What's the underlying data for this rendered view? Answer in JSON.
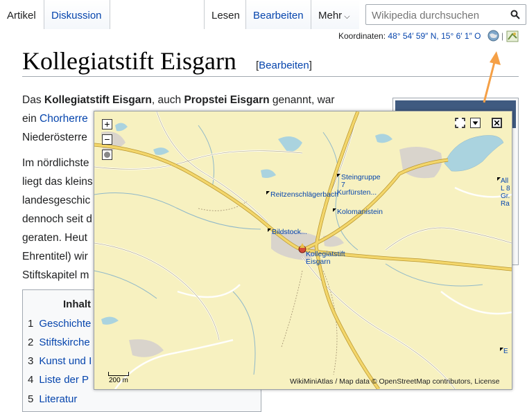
{
  "tabs": {
    "artikel": "Artikel",
    "diskussion": "Diskussion",
    "lesen": "Lesen",
    "bearbeiten": "Bearbeiten",
    "mehr": "Mehr"
  },
  "search": {
    "placeholder": "Wikipedia durchsuchen"
  },
  "coordinates": {
    "label": "Koordinaten:",
    "lat": "48° 54′ 59″ N,",
    "lon": "15° 6′ 1″ O"
  },
  "title": "Kollegiatstift Eisgarn",
  "title_edit": "Bearbeiten",
  "paragraph1": {
    "line1_pre": "Das ",
    "line1_b1": "Kollegiatstift Eisgarn",
    "line1_mid": ", auch ",
    "line1_b2": "Propstei Eisgarn",
    "line1_post": " genannt, war",
    "line2_pre": "ein ",
    "line2_link": "Chorherre",
    "line3": "Niederösterre"
  },
  "paragraph2": {
    "lines": [
      "Im nördlichste",
      "liegt das kleins",
      "landesgeschic",
      "dennoch seit d",
      "geraten. Heut",
      "Ehrentitel) wir",
      "Stiftskapitel m"
    ]
  },
  "toc": {
    "title": "Inhalt",
    "items": [
      {
        "num": "1",
        "label": "Geschichte"
      },
      {
        "num": "2",
        "label": "Stiftskirche"
      },
      {
        "num": "3",
        "label": "Kunst und I"
      },
      {
        "num": "4",
        "label": "Liste der P"
      },
      {
        "num": "5",
        "label": "Literatur"
      }
    ]
  },
  "map": {
    "labels": {
      "steingruppe": [
        "Steingruppe",
        "7",
        "Kurfürsten..."
      ],
      "reitzenschlag": "Reitzenschlägerbach",
      "kolomani": "Kolomanistein",
      "bildstock": "Bildstock...",
      "stift": [
        "Kollegiatstift",
        "Eisgarn"
      ]
    },
    "edge_labels": [
      "All",
      "L 8",
      "Gr.",
      "Ra",
      "E"
    ],
    "scale": "200 m",
    "attribution": "WikiMiniAtlas / Map data © OpenStreetMap contributors, License",
    "buttons": {
      "zoom_in": "+",
      "zoom_out": "−"
    }
  },
  "colors": {
    "link": "#0645ad",
    "map_bg": "#f7f1c0",
    "water": "#aad3df",
    "road_major": "#f3d66b",
    "arrow": "#f5a046"
  }
}
